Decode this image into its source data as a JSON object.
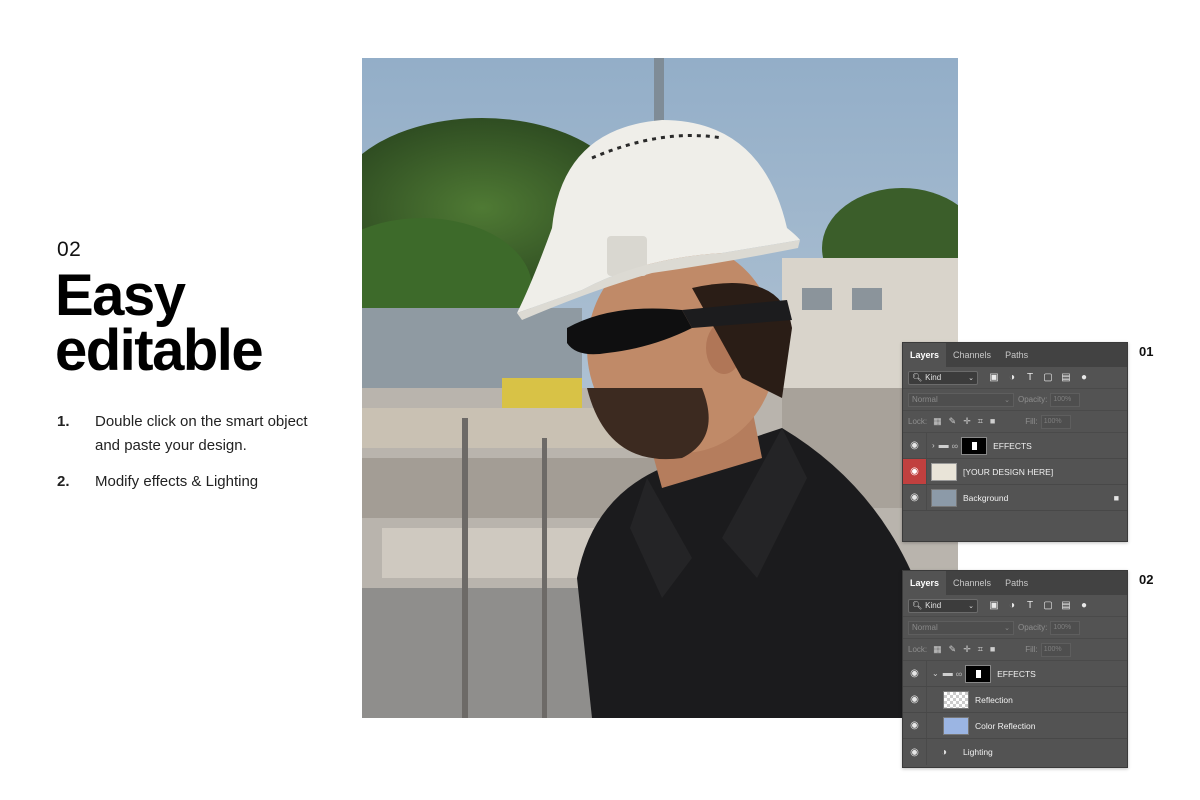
{
  "intro": {
    "step_number": "02",
    "headline_line1": "Easy",
    "headline_line2": "editable",
    "steps": [
      {
        "num": "1.",
        "text": "Double click on the smart object and paste your design."
      },
      {
        "num": "2.",
        "text": "Modify effects & Lighting"
      }
    ]
  },
  "panel1": {
    "label": "01",
    "tabs": [
      "Layers",
      "Channels",
      "Paths"
    ],
    "kind_label": "Kind",
    "blend_mode": "Normal",
    "opacity_label": "Opacity:",
    "opacity_value": "100%",
    "lock_label": "Lock:",
    "fill_label": "Fill:",
    "fill_value": "100%",
    "layers": [
      {
        "name": "EFFECTS"
      },
      {
        "name": "[YOUR DESIGN HERE]"
      },
      {
        "name": "Background"
      }
    ]
  },
  "panel2": {
    "label": "02",
    "tabs": [
      "Layers",
      "Channels",
      "Paths"
    ],
    "kind_label": "Kind",
    "blend_mode": "Normal",
    "opacity_label": "Opacity:",
    "opacity_value": "100%",
    "lock_label": "Lock:",
    "fill_label": "Fill:",
    "fill_value": "100%",
    "layers": [
      {
        "name": "EFFECTS"
      },
      {
        "name": "Reflection"
      },
      {
        "name": "Color Reflection"
      },
      {
        "name": "Lighting"
      }
    ]
  },
  "colors": {
    "panel_bg": "#535353",
    "selected_eye": "#c1403f",
    "color_reflection_swatch": "#9bb5e3"
  }
}
